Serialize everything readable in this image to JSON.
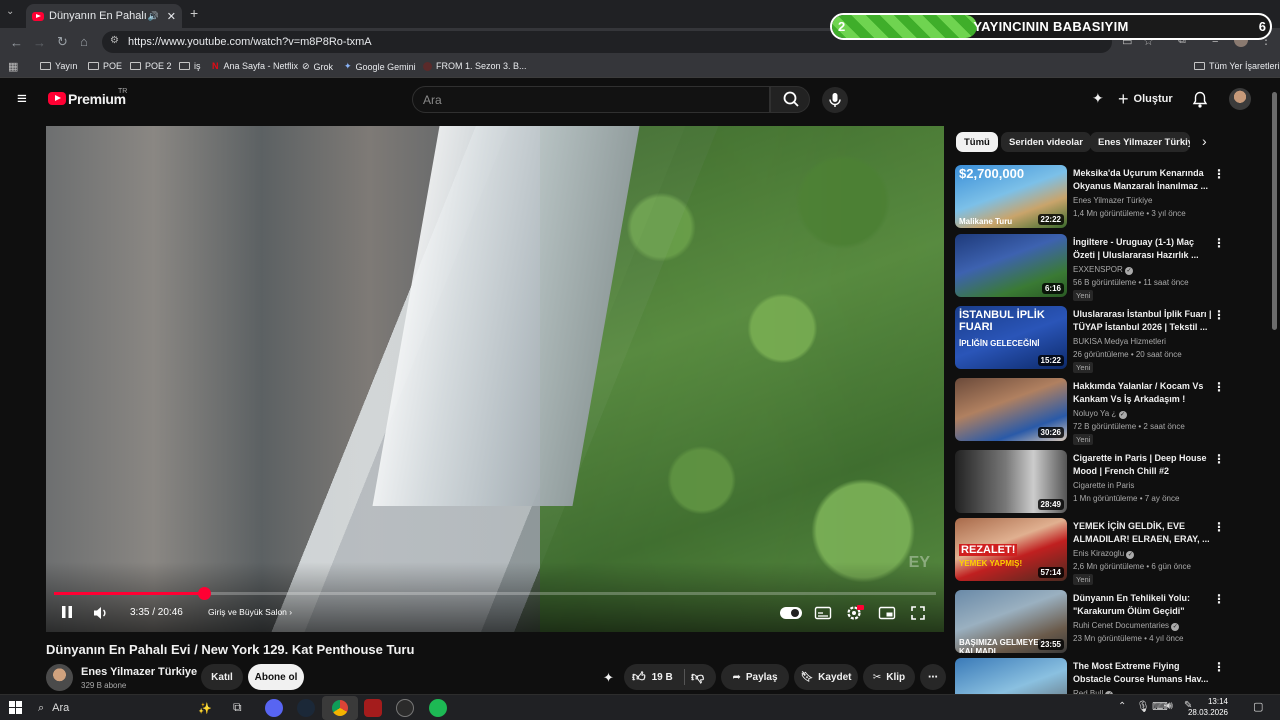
{
  "browser": {
    "tab_title": "Dünyanın En Pahalı Evi / N",
    "url": "https://www.youtube.com/watch?v=m8P8Ro-txmA",
    "bookmarks": [
      {
        "label": "Yayın",
        "icon": "folder-icon"
      },
      {
        "label": "POE",
        "icon": "folder-icon"
      },
      {
        "label": "POE 2",
        "icon": "folder-icon"
      },
      {
        "label": "iş",
        "icon": "folder-icon"
      },
      {
        "label": "Ana Sayfa - Netflix",
        "icon": "netflix-icon"
      },
      {
        "label": "Grok",
        "icon": "grok-icon"
      },
      {
        "label": "Google Gemini",
        "icon": "gemini-icon"
      },
      {
        "label": "FROM 1. Sezon 3. B...",
        "icon": "site-icon"
      }
    ],
    "all_bookmarks": "Tüm Yer İşaretleri"
  },
  "overlay": {
    "left_number": "2",
    "title": "YAYINCININ BABASIYIM",
    "right_number": "6",
    "progress": 0.33
  },
  "youtube": {
    "logo_text": "Premium",
    "logo_region": "TR",
    "search_placeholder": "Ara",
    "create_label": "Oluştur",
    "colors": {
      "brand": "#ff0033",
      "background": "#0f0f0f"
    }
  },
  "player": {
    "time": "3:35 / 20:46",
    "chapter": "Giriş ve Büyük Salon",
    "watermark": "EY",
    "progress": 0.17
  },
  "video": {
    "title": "Dünyanın En Pahalı Evi / New York 129. Kat Penthouse Turu",
    "channel": "Enes Yilmazer Türkiye",
    "subscribers": "329 B abone",
    "join_label": "Katıl",
    "subscribe_label": "Abone ol",
    "likes": "19 B",
    "share_label": "Paylaş",
    "save_label": "Kaydet",
    "clip_label": "Klip"
  },
  "chips": [
    "Tümü",
    "Seriden videolar",
    "Enes Yilmazer Türkiye"
  ],
  "recommendations": [
    {
      "title": "Meksika'da Uçurum Kenarında Okyanus Manzaralı İnanılmaz ...",
      "channel": "Enes Yilmazer Türkiye",
      "verified": false,
      "meta": "1,4 Mn görüntüleme • 3 yıl önce",
      "duration": "22:22",
      "badge": "",
      "thumb_text": "$2,700,000",
      "thumb_sub": "Malikane Turu"
    },
    {
      "title": "İngiltere - Uruguay (1-1) Maç Özeti | Uluslararası Hazırlık ...",
      "channel": "EXXENSPOR",
      "verified": true,
      "meta": "56 B görüntüleme • 11 saat önce",
      "duration": "6:16",
      "badge": "Yeni",
      "thumb_text": "",
      "thumb_sub": ""
    },
    {
      "title": "Uluslararası İstanbul İplik Fuarı | TÜYAP İstanbul 2026 | Tekstil ...",
      "channel": "BUKISA Medya Hizmetleri",
      "verified": false,
      "meta": "26 görüntüleme • 20 saat önce",
      "duration": "15:22",
      "badge": "Yeni",
      "thumb_text": "İSTANBUL İPLİK FUARI",
      "thumb_sub": "İPLİĞİN GELECEĞİNİ"
    },
    {
      "title": "Hakkımda Yalanlar / Kocam Vs Kankam Vs İş Arkadaşım !",
      "channel": "Noluyo Ya ¿",
      "verified": true,
      "meta": "72 B görüntüleme • 2 saat önce",
      "duration": "30:26",
      "badge": "Yeni",
      "thumb_text": "",
      "thumb_sub": ""
    },
    {
      "title": "Cigarette in Paris | Deep House Mood | French Chill #2",
      "channel": "Cigarette in Paris",
      "verified": false,
      "meta": "1 Mn görüntüleme • 7 ay önce",
      "duration": "28:49",
      "badge": "",
      "thumb_text": "",
      "thumb_sub": ""
    },
    {
      "title": "YEMEK İÇİN GELDİK, EVE ALMADILAR! ELRAEN, ERAY, ...",
      "channel": "Enis Kirazoglu",
      "verified": true,
      "meta": "2,6 Mn görüntüleme • 6 gün önce",
      "duration": "57:14",
      "badge": "Yeni",
      "thumb_text": "REZALET!",
      "thumb_sub": "YEMEK YAPMIŞ!"
    },
    {
      "title": "Dünyanın En Tehlikeli Yolu: \"Karakurum Ölüm Geçidi\"",
      "channel": "Ruhi Cenet Documentaries",
      "verified": true,
      "meta": "23 Mn görüntüleme • 4 yıl önce",
      "duration": "23:55",
      "badge": "",
      "thumb_text": "",
      "thumb_sub": "BAŞIMIZA GELMEYEN KALMADI"
    },
    {
      "title": "The Most Extreme Flying Obstacle Course Humans Hav...",
      "channel": "Red Bull",
      "verified": true,
      "meta": "",
      "duration": "",
      "badge": "",
      "thumb_text": "",
      "thumb_sub": ""
    }
  ],
  "taskbar": {
    "search_placeholder": "Ara",
    "time": "13:14",
    "date": "28.03.2026"
  }
}
